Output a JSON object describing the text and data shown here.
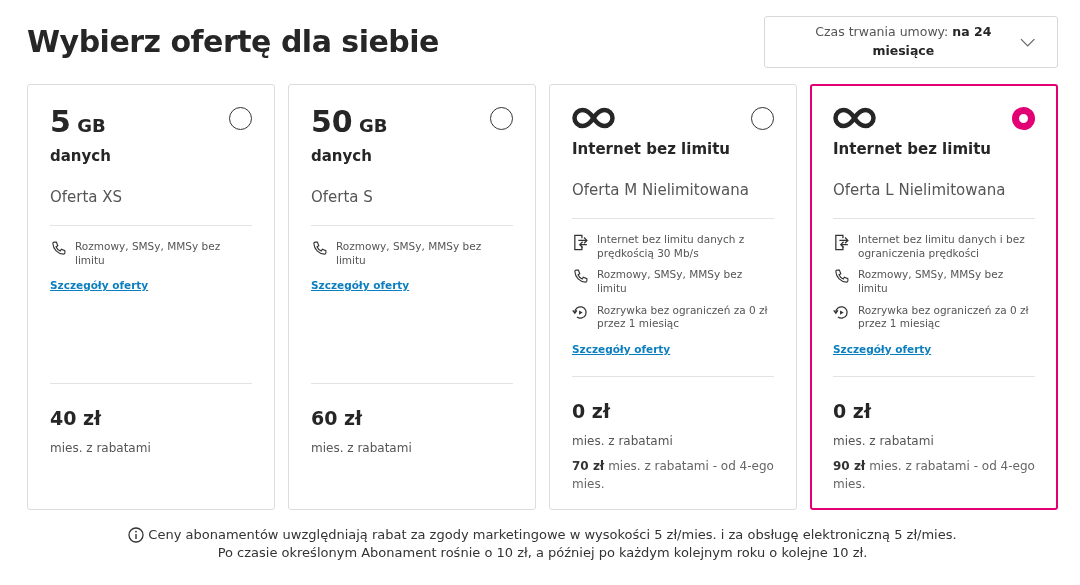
{
  "title": "Wybierz ofertę dla siebie",
  "duration_select": {
    "label": "Czas trwania umowy: **na 24 miesiące**"
  },
  "offers": [
    {
      "kind": "amount",
      "amount": "5",
      "unit": "GB",
      "subtitle": "danych",
      "name": "Oferta XS",
      "selected": false,
      "features": [
        {
          "kind": "calls",
          "text": "Rozmowy, SMSy, MMSy bez limitu"
        }
      ],
      "details_link": "Szczegóły oferty",
      "price": "40 zł",
      "price_note": "mies. z rabatami"
    },
    {
      "kind": "amount",
      "amount": "50",
      "unit": "GB",
      "subtitle": "danych",
      "name": "Oferta S",
      "selected": false,
      "features": [
        {
          "kind": "calls",
          "text": "Rozmowy, SMSy, MMSy bez limitu"
        }
      ],
      "details_link": "Szczegóły oferty",
      "price": "60 zł",
      "price_note": "mies. z rabatami"
    },
    {
      "kind": "unlimited",
      "subtitle": "Internet bez limitu",
      "name": "Oferta M Nielimitowana",
      "selected": false,
      "features": [
        {
          "kind": "data",
          "text": "Internet bez limitu danych z prędkością 30 Mb/s"
        },
        {
          "kind": "calls",
          "text": "Rozmowy, SMSy, MMSy bez limitu"
        },
        {
          "kind": "entertainment",
          "text": "Rozrywka bez ograniczeń za 0 zł przez 1 miesiąc"
        }
      ],
      "details_link": "Szczegóły oferty",
      "price": "0 zł",
      "price_note": "mies. z rabatami",
      "later_price": "**70 zł** mies. z rabatami - od 4-ego mies."
    },
    {
      "kind": "unlimited",
      "subtitle": "Internet bez limitu",
      "name": "Oferta L Nielimitowana",
      "selected": true,
      "features": [
        {
          "kind": "data",
          "text": "Internet bez limitu danych i bez ograniczenia prędkości"
        },
        {
          "kind": "calls",
          "text": "Rozmowy, SMSy, MMSy bez limitu"
        },
        {
          "kind": "entertainment",
          "text": "Rozrywka bez ograniczeń za 0 zł przez 1 miesiąc"
        }
      ],
      "details_link": "Szczegóły oferty",
      "price": "0 zł",
      "price_note": "mies. z rabatami",
      "later_price": "**90 zł** mies. z rabatami - od 4-ego mies."
    }
  ],
  "footnote": [
    "Ceny abonamentów uwzględniają rabat za zgody marketingowe w wysokości 5 zł/mies. i za obsługę elektroniczną 5 zł/mies.",
    "Po czasie określonym Abonament rośnie o 10 zł, a później po każdym kolejnym roku o kolejne 10 zł."
  ]
}
